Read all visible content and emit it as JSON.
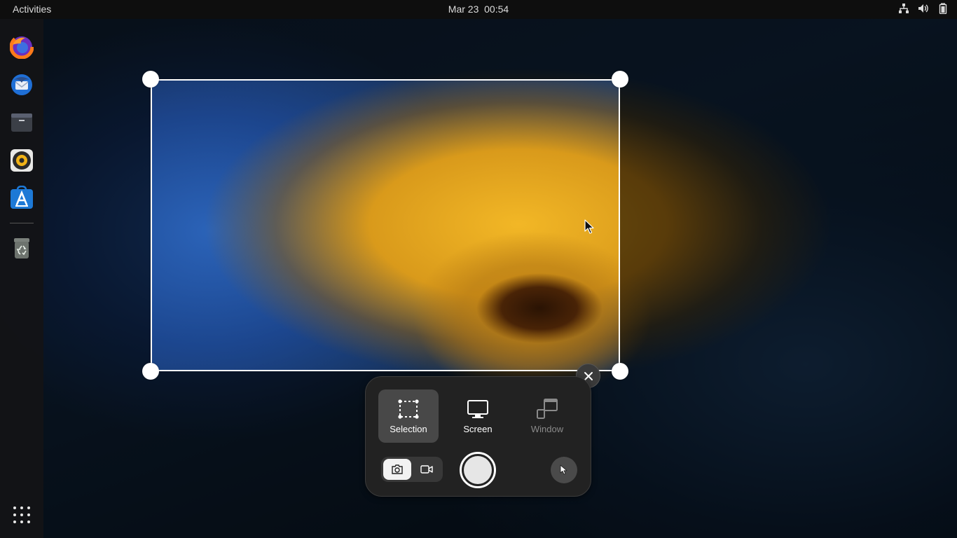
{
  "topbar": {
    "activities": "Activities",
    "clock": "Mar 23  00:54",
    "tray": [
      "network-icon",
      "volume-icon",
      "battery-icon"
    ]
  },
  "dock": {
    "apps": [
      "firefox",
      "thunderbird",
      "files",
      "rhythmbox",
      "ubuntu-software",
      "trash"
    ],
    "show_apps_icon": "app-grid-icon"
  },
  "screenshot_ui": {
    "modes": [
      {
        "label": "Selection",
        "state": "active"
      },
      {
        "label": "Screen",
        "state": "normal"
      },
      {
        "label": "Window",
        "state": "disabled"
      }
    ],
    "capture_types": [
      "screenshot",
      "screencast"
    ],
    "selected_capture_type": "screenshot",
    "show_pointer_icon": "pointer-icon",
    "close_icon": "close-icon",
    "accent": "#ffffff"
  }
}
